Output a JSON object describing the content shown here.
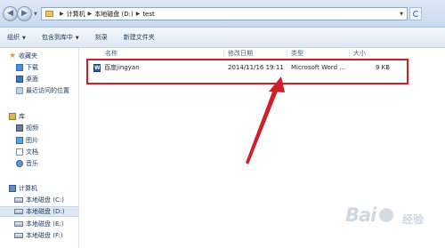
{
  "address_bar": {
    "crumbs": [
      "计算机",
      "本地磁盘 (D:)",
      "test"
    ]
  },
  "command_bar": {
    "organize": "组织",
    "include_in_library": "包含到库中",
    "burn": "刻录",
    "new_folder": "新建文件夹"
  },
  "nav_pane": {
    "favorites": {
      "label": "收藏夹",
      "items": [
        "下载",
        "桌面",
        "最近访问的位置"
      ]
    },
    "libraries": {
      "label": "库",
      "items": [
        "视频",
        "图片",
        "文档",
        "音乐"
      ]
    },
    "computer": {
      "label": "计算机",
      "drives": [
        "本地磁盘 (C:)",
        "本地磁盘 (D:)",
        "本地磁盘 (E:)",
        "本地磁盘 (F:)"
      ],
      "selected_drive": "本地磁盘 (D:)"
    }
  },
  "columns": {
    "name": "名称",
    "modified": "修改日期",
    "type": "类型",
    "size": "大小"
  },
  "files": [
    {
      "name": "百度jingyan",
      "modified": "2014/11/16 19:11",
      "type": "Microsoft Word ...",
      "size": "9 KB",
      "icon": "word-doc-icon"
    }
  ],
  "annotation": {
    "highlight_color": "#d11f2a",
    "arrow_color": "#d11f2a"
  },
  "watermark": {
    "text": "Bai",
    "sub": "经验"
  }
}
